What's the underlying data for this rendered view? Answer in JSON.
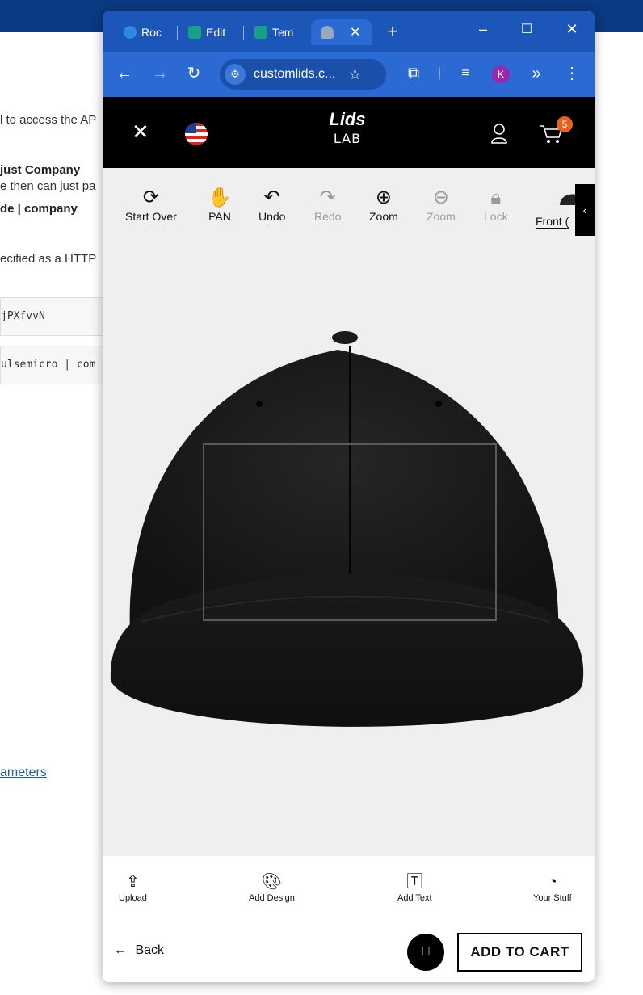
{
  "background_page": {
    "line1": "l to access the AP",
    "line2": "just Company",
    "line3": "e then can just pa",
    "line4": "de | company",
    "line5": "ecified as a HTTP",
    "code1": "jPXfvvN",
    "code2": "ulsemicro | com",
    "link": "ameters"
  },
  "browser": {
    "tabs": [
      {
        "label": "Roc",
        "color": "#2b6ad3"
      },
      {
        "label": "Edit",
        "color": "#16a085"
      },
      {
        "label": "Tem",
        "color": "#16a085"
      },
      {
        "label": "",
        "color": "#9aa8bd"
      }
    ],
    "url": "customlids.c...",
    "avatar": "K"
  },
  "header": {
    "logo_top": "Lids",
    "logo_bottom": "LAB",
    "cart_count": "5"
  },
  "toolbar": {
    "items": [
      {
        "label": "Start Over",
        "icon": "refresh-icon"
      },
      {
        "label": "PAN",
        "icon": "hand-icon"
      },
      {
        "label": "Undo",
        "icon": "undo-icon"
      },
      {
        "label": "Redo",
        "icon": "redo-icon"
      },
      {
        "label": "Zoom",
        "icon": "zoom-in-icon"
      },
      {
        "label": "Zoom",
        "icon": "zoom-out-icon"
      },
      {
        "label": "Lock",
        "icon": "lock-icon"
      }
    ],
    "view": "Front ("
  },
  "bottom_tools": [
    {
      "label": "Upload",
      "icon": "upload-icon"
    },
    {
      "label": "Add Design",
      "icon": "palette-icon"
    },
    {
      "label": "Add Text",
      "icon": "text-icon"
    },
    {
      "label": "Your Stuff",
      "icon": "history-icon"
    }
  ],
  "footer": {
    "back": "Back",
    "add_to_cart": "ADD TO CART"
  }
}
